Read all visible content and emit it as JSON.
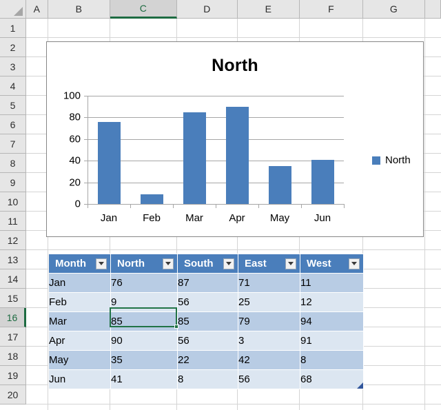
{
  "grid": {
    "columns": [
      {
        "label": "A",
        "selected": false
      },
      {
        "label": "B",
        "selected": false
      },
      {
        "label": "C",
        "selected": true
      },
      {
        "label": "D",
        "selected": false
      },
      {
        "label": "E",
        "selected": false
      },
      {
        "label": "F",
        "selected": false
      },
      {
        "label": "G",
        "selected": false
      }
    ],
    "rows": [
      {
        "label": "1",
        "selected": false
      },
      {
        "label": "2",
        "selected": false
      },
      {
        "label": "3",
        "selected": false
      },
      {
        "label": "4",
        "selected": false
      },
      {
        "label": "5",
        "selected": false
      },
      {
        "label": "6",
        "selected": false
      },
      {
        "label": "7",
        "selected": false
      },
      {
        "label": "8",
        "selected": false
      },
      {
        "label": "9",
        "selected": false
      },
      {
        "label": "10",
        "selected": false
      },
      {
        "label": "11",
        "selected": false
      },
      {
        "label": "12",
        "selected": false
      },
      {
        "label": "13",
        "selected": false
      },
      {
        "label": "14",
        "selected": false
      },
      {
        "label": "15",
        "selected": false
      },
      {
        "label": "16",
        "selected": true
      },
      {
        "label": "17",
        "selected": false
      },
      {
        "label": "18",
        "selected": false
      },
      {
        "label": "19",
        "selected": false
      },
      {
        "label": "20",
        "selected": false
      }
    ],
    "active_cell": {
      "column": "C",
      "row": "16",
      "value": "85"
    },
    "select_all_icon": "select-all-triangle-icon"
  },
  "chart_data": {
    "type": "bar",
    "title": "North",
    "categories": [
      "Jan",
      "Feb",
      "Mar",
      "Apr",
      "May",
      "Jun"
    ],
    "series": [
      {
        "name": "North",
        "values": [
          76,
          9,
          85,
          90,
          35,
          41
        ],
        "color": "#4a7ebb"
      }
    ],
    "xlabel": "",
    "ylabel": "",
    "ylim": [
      0,
      100
    ],
    "yticks": [
      0,
      20,
      40,
      60,
      80,
      100
    ],
    "grid": true,
    "legend": {
      "position": "right",
      "entries": [
        "North"
      ]
    }
  },
  "table": {
    "headers": [
      "Month",
      "North",
      "South",
      "East",
      "West"
    ],
    "filter_icon": "filter-dropdown-icon",
    "rows": [
      {
        "sheet_row": "14",
        "cells": [
          "Jan",
          "76",
          "87",
          "71",
          "11"
        ]
      },
      {
        "sheet_row": "15",
        "cells": [
          "Feb",
          "9",
          "56",
          "25",
          "12"
        ]
      },
      {
        "sheet_row": "16",
        "cells": [
          "Mar",
          "85",
          "85",
          "79",
          "94"
        ]
      },
      {
        "sheet_row": "17",
        "cells": [
          "Apr",
          "90",
          "56",
          "3",
          "91"
        ]
      },
      {
        "sheet_row": "18",
        "cells": [
          "May",
          "35",
          "22",
          "42",
          "8"
        ]
      },
      {
        "sheet_row": "19",
        "cells": [
          "Jun",
          "41",
          "8",
          "56",
          "68"
        ]
      }
    ],
    "colors": {
      "header_fill": "#4a7ebb",
      "band_dark": "#b8cce4",
      "band_light": "#dce6f1",
      "active_cell_border": "#217346",
      "resize_handle": "#31569c"
    }
  }
}
